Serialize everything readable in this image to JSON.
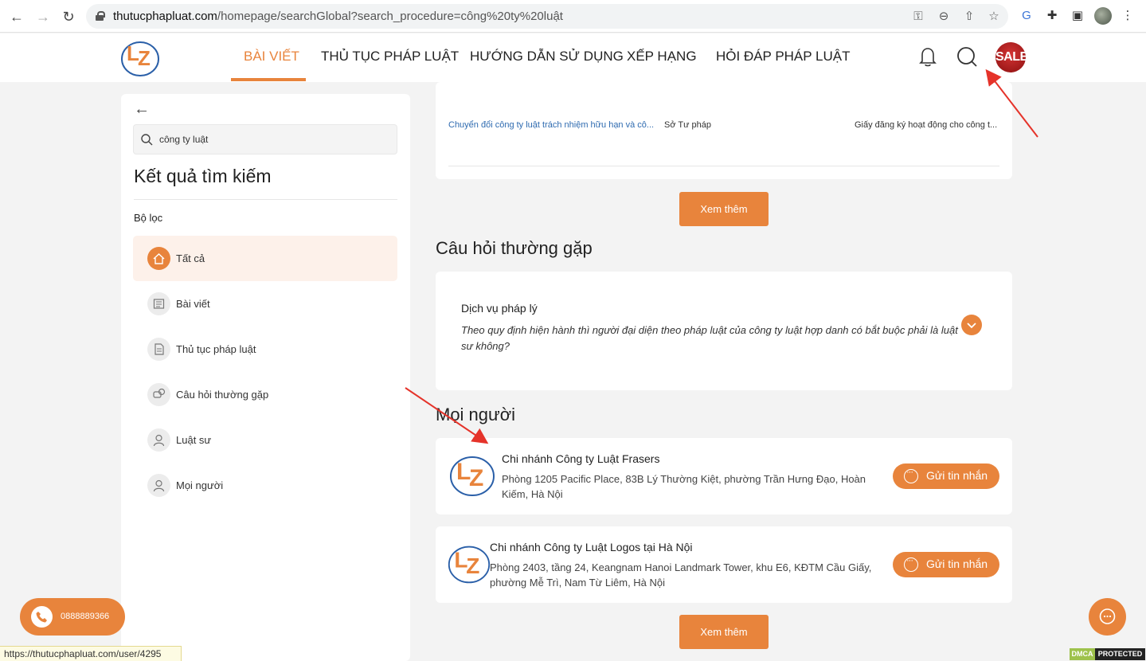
{
  "browser": {
    "url_host": "thutucphapluat.com",
    "url_path": "/homepage/searchGlobal?search_procedure=công%20ty%20luật"
  },
  "header": {
    "nav": [
      "BÀI VIẾT",
      "THỦ TỤC PHÁP LUẬT",
      "HƯỚNG DẪN SỬ DỤNG",
      "XẾP HẠNG",
      "HỎI ĐÁP PHÁP LUẬT"
    ],
    "active_nav": "BÀI VIẾT",
    "sale_label": "SALE",
    "accent_color": "#e8843c"
  },
  "sidebar": {
    "search_value": "công ty luật",
    "title": "Kết quả tìm kiếm",
    "filter_label": "Bộ lọc",
    "filters": [
      "Tất cả",
      "Bài viết",
      "Thủ tục pháp luật",
      "Câu hỏi thường gặp",
      "Luật sư",
      "Mọi người"
    ]
  },
  "procedures": {
    "row": {
      "name": "Chuyển đổi công ty luật trách nhiệm hữu hạn và cô...",
      "agency": "Sở Tư pháp",
      "result": "Giấy đăng ký hoạt động cho công t..."
    },
    "more_label": "Xem thêm"
  },
  "faq": {
    "section_title": "Câu hỏi thường gặp",
    "items": [
      {
        "question": "Dịch vụ pháp lý",
        "answer": "Theo quy định hiện hành thì người đại diện theo pháp luật của công ty luật hợp danh có bắt buộc phải là luật sư không?"
      }
    ]
  },
  "people": {
    "section_title": "Mọi người",
    "items": [
      {
        "name": "Chi nhánh Công ty Luật Frasers",
        "address": "Phòng 1205 Pacific Place, 83B Lý Thường Kiệt, phường Trần Hưng Đạo, Hoàn Kiếm, Hà Nội",
        "button": "Gửi tin nhắn"
      },
      {
        "name": "Chi nhánh Công ty Luật Logos tại Hà Nội",
        "address": "Phòng 2403, tầng 24, Keangnam Hanoi Landmark Tower, khu E6, KĐTM Cầu Giấy, phường Mễ Trì, Nam Từ Liêm, Hà Nội",
        "button": "Gửi tin nhắn"
      }
    ],
    "more_label": "Xem thêm"
  },
  "floating": {
    "phone": "0888889366",
    "status_url": "https://thutucphapluat.com/user/4295",
    "dmca_1": "DMCA",
    "dmca_2": "PROTECTED"
  }
}
